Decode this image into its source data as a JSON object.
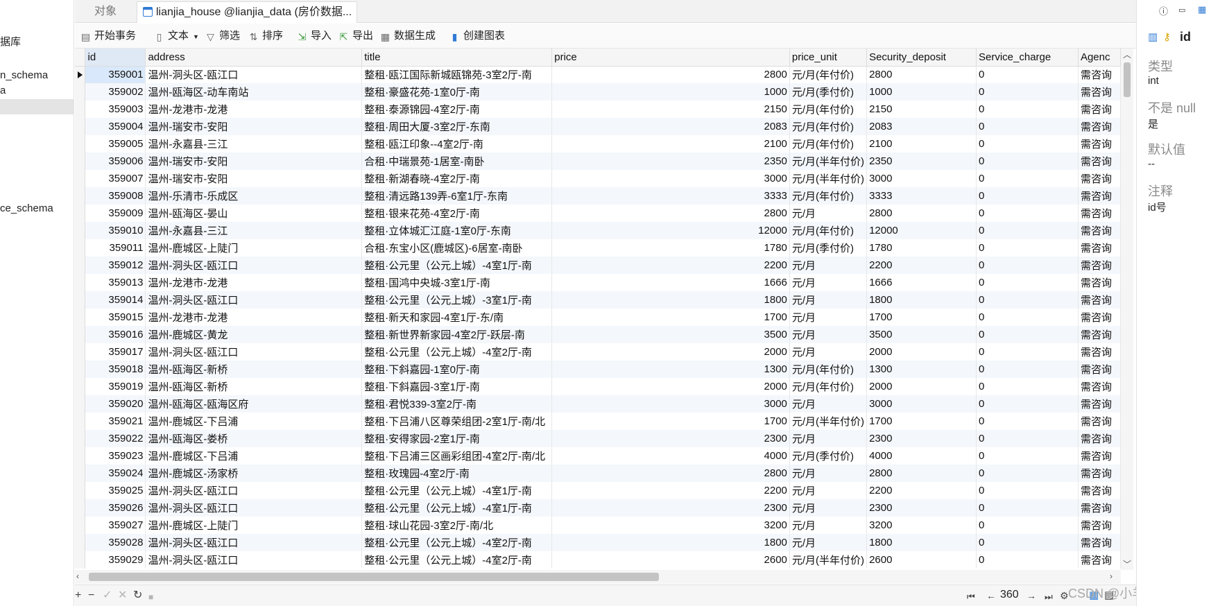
{
  "navigator": {
    "items": [
      {
        "label": "据库"
      },
      {
        "label": "n_schema"
      },
      {
        "label": "a"
      },
      {
        "label": ""
      },
      {
        "label": "ce_schema"
      }
    ]
  },
  "tabs": {
    "objects_label": "对象",
    "table_tab_label": "lianjia_house @lianjia_data (房价数据..."
  },
  "toolbar": {
    "begin_transaction": "开始事务",
    "text": "文本",
    "filter": "筛选",
    "sort": "排序",
    "import": "导入",
    "export": "导出",
    "data_generate": "数据生成",
    "create_chart": "创建图表"
  },
  "grid": {
    "columns": [
      "id",
      "address",
      "title",
      "price",
      "price_unit",
      "Security_deposit",
      "Service_charge",
      "Agenc"
    ],
    "rows": [
      [
        "359001",
        "温州-洞头区-瓯江口",
        "整租·瓯江国际新城瓯锦苑-3室2厅-南",
        "2800",
        "元/月(年付价)",
        "2800",
        "0",
        "需咨询"
      ],
      [
        "359002",
        "温州-瓯海区-动车南站",
        "整租·豪盛花苑-1室0厅-南",
        "1000",
        "元/月(季付价)",
        "1000",
        "0",
        "需咨询"
      ],
      [
        "359003",
        "温州-龙港市-龙港",
        "整租·泰源锦园-4室2厅-南",
        "2150",
        "元/月(年付价)",
        "2150",
        "0",
        "需咨询"
      ],
      [
        "359004",
        "温州-瑞安市-安阳",
        "整租·周田大厦-3室2厅-东南",
        "2083",
        "元/月(年付价)",
        "2083",
        "0",
        "需咨询"
      ],
      [
        "359005",
        "温州-永嘉县-三江",
        "整租·瓯江印象--4室2厅-南",
        "2100",
        "元/月(年付价)",
        "2100",
        "0",
        "需咨询"
      ],
      [
        "359006",
        "温州-瑞安市-安阳",
        "合租·中瑞景苑-1居室-南卧",
        "2350",
        "元/月(半年付价)",
        "2350",
        "0",
        "需咨询"
      ],
      [
        "359007",
        "温州-瑞安市-安阳",
        "整租·新湖春晓-4室2厅-南",
        "3000",
        "元/月(半年付价)",
        "3000",
        "0",
        "需咨询"
      ],
      [
        "359008",
        "温州-乐清市-乐成区",
        "整租·清远路139弄-6室1厅-东南",
        "3333",
        "元/月(年付价)",
        "3333",
        "0",
        "需咨询"
      ],
      [
        "359009",
        "温州-瓯海区-晏山",
        "整租·银来花苑-4室2厅-南",
        "2800",
        "元/月",
        "2800",
        "0",
        "需咨询"
      ],
      [
        "359010",
        "温州-永嘉县-三江",
        "整租·立体城汇江庭-1室0厅-东南",
        "12000",
        "元/月(年付价)",
        "12000",
        "0",
        "需咨询"
      ],
      [
        "359011",
        "温州-鹿城区-上陡门",
        "合租·东宝小区(鹿城区)-6居室-南卧",
        "1780",
        "元/月(季付价)",
        "1780",
        "0",
        "需咨询"
      ],
      [
        "359012",
        "温州-洞头区-瓯江口",
        "整租·公元里（公元上城）-4室1厅-南",
        "2200",
        "元/月",
        "2200",
        "0",
        "需咨询"
      ],
      [
        "359013",
        "温州-龙港市-龙港",
        "整租·国鸿中央城-3室1厅-南",
        "1666",
        "元/月",
        "1666",
        "0",
        "需咨询"
      ],
      [
        "359014",
        "温州-洞头区-瓯江口",
        "整租·公元里（公元上城）-3室1厅-南",
        "1800",
        "元/月",
        "1800",
        "0",
        "需咨询"
      ],
      [
        "359015",
        "温州-龙港市-龙港",
        "整租·新天和家园-4室1厅-东/南",
        "1700",
        "元/月",
        "1700",
        "0",
        "需咨询"
      ],
      [
        "359016",
        "温州-鹿城区-黄龙",
        "整租·新世界新家园-4室2厅-跃层-南",
        "3500",
        "元/月",
        "3500",
        "0",
        "需咨询"
      ],
      [
        "359017",
        "温州-洞头区-瓯江口",
        "整租·公元里（公元上城）-4室2厅-南",
        "2000",
        "元/月",
        "2000",
        "0",
        "需咨询"
      ],
      [
        "359018",
        "温州-瓯海区-新桥",
        "整租·下斜嘉园-1室0厅-南",
        "1300",
        "元/月(年付价)",
        "1300",
        "0",
        "需咨询"
      ],
      [
        "359019",
        "温州-瓯海区-新桥",
        "整租·下斜嘉园-3室1厅-南",
        "2000",
        "元/月(年付价)",
        "2000",
        "0",
        "需咨询"
      ],
      [
        "359020",
        "温州-瓯海区-瓯海区府",
        "整租·君悦339-3室2厅-南",
        "3000",
        "元/月",
        "3000",
        "0",
        "需咨询"
      ],
      [
        "359021",
        "温州-鹿城区-下吕浦",
        "整租·下吕浦八区尊荣组团-2室1厅-南/北",
        "1700",
        "元/月(半年付价)",
        "1700",
        "0",
        "需咨询"
      ],
      [
        "359022",
        "温州-瓯海区-娄桥",
        "整租·安得家园-2室1厅-南",
        "2300",
        "元/月",
        "2300",
        "0",
        "需咨询"
      ],
      [
        "359023",
        "温州-鹿城区-下吕浦",
        "整租·下吕浦三区画彩组团-4室2厅-南/北",
        "4000",
        "元/月(季付价)",
        "4000",
        "0",
        "需咨询"
      ],
      [
        "359024",
        "温州-鹿城区-汤家桥",
        "整租·玫瑰园-4室2厅-南",
        "2800",
        "元/月",
        "2800",
        "0",
        "需咨询"
      ],
      [
        "359025",
        "温州-洞头区-瓯江口",
        "整租·公元里（公元上城）-4室1厅-南",
        "2200",
        "元/月",
        "2200",
        "0",
        "需咨询"
      ],
      [
        "359026",
        "温州-洞头区-瓯江口",
        "整租·公元里（公元上城）-4室1厅-南",
        "2300",
        "元/月",
        "2300",
        "0",
        "需咨询"
      ],
      [
        "359027",
        "温州-鹿城区-上陡门",
        "整租·球山花园-3室2厅-南/北",
        "3200",
        "元/月",
        "3200",
        "0",
        "需咨询"
      ],
      [
        "359028",
        "温州-洞头区-瓯江口",
        "整租·公元里（公元上城）-4室2厅-南",
        "1800",
        "元/月",
        "1800",
        "0",
        "需咨询"
      ],
      [
        "359029",
        "温州-洞头区-瓯江口",
        "整租·公元里（公元上城）-4室2厅-南",
        "2600",
        "元/月(半年付价)",
        "2600",
        "0",
        "需咨询"
      ]
    ]
  },
  "bottom_bar": {
    "add": "+",
    "remove": "−",
    "apply": "✓",
    "discard": "✕",
    "refresh": "↻",
    "stop": "■",
    "page_number": "360"
  },
  "watermark": "CSDN @小羊只会print",
  "info_panel": {
    "field_name": "id",
    "type_label": "类型",
    "type_value": "int",
    "not_null_label": "不是 null",
    "not_null_value": "是",
    "default_label": "默认值",
    "default_value": "--",
    "comment_label": "注释",
    "comment_value": "id号"
  }
}
